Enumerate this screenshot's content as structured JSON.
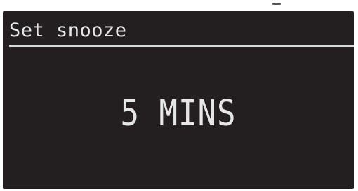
{
  "display": {
    "title": "Set snooze",
    "value": "5 MINS"
  }
}
